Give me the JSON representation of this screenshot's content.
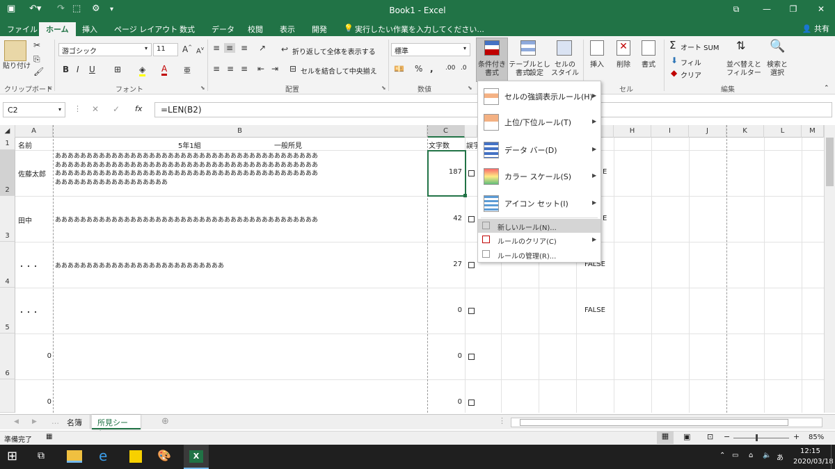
{
  "window": {
    "title": "Book1 - Excel"
  },
  "tabs": {
    "items": [
      "ファイル",
      "ホーム",
      "挿入",
      "ページ レイアウト",
      "数式",
      "データ",
      "校閲",
      "表示",
      "開発"
    ],
    "tellme": "実行したい作業を入力してください...",
    "share": "共有"
  },
  "ribbon": {
    "paste": "貼り付け",
    "font_name": "游ゴシック",
    "font_size": "11",
    "wrap_text": "折り返して全体を表示する",
    "merge_center": "セルを結合して中央揃え",
    "number_format": "標準",
    "cond_format_1": "条件付き",
    "cond_format_2": "書式",
    "table_format_1": "テーブルとして",
    "table_format_2": "書式設定",
    "cell_style_1": "セルの",
    "cell_style_2": "スタイル",
    "insert": "挿入",
    "delete": "削除",
    "format": "書式",
    "autosum": "オート SUM",
    "fill": "フィル",
    "clear": "クリア",
    "sort_1": "並べ替えと",
    "sort_2": "フィルター",
    "find_1": "検索と",
    "find_2": "選択",
    "groups": {
      "clipboard": "クリップボード",
      "font": "フォント",
      "alignment": "配置",
      "number": "数値",
      "cells": "セル",
      "editing": "編集"
    }
  },
  "formula_bar": {
    "namebox": "C2",
    "formula": "=LEN(B2)",
    "fx": "fx"
  },
  "columns": [
    "A",
    "B",
    "C",
    "",
    "",
    "",
    "",
    "",
    "H",
    "I",
    "J",
    "K",
    "L",
    "M"
  ],
  "rows": [
    "1",
    "2",
    "3",
    "4",
    "5",
    "6"
  ],
  "cells": {
    "a1": "名前",
    "b1_left": "5年1組",
    "b1_right": "一般所見",
    "c1": "文字数",
    "d1": "誤字",
    "a2": "佐藤太郎",
    "b2_lines": [
      "ああああああああああああああああああああああああああああああああああああああああああ",
      "ああああああああああああああああああああああああああああああああああああああああああ",
      "ああああああああああああああああああああああああああああああああああああああああああ",
      "ああああああああああああああああああ"
    ],
    "c2": "187",
    "h2": "E",
    "a3": "田中",
    "b3": "ああああああああああああああああああああああああああああああああああああああああああ",
    "c3": "42",
    "h3": "E",
    "a4": "・・・",
    "b4": "あああああああああああああああああああああああああああ",
    "c4": "27",
    "h4": "FALSE",
    "a5": "・・・",
    "c5": "0",
    "h5": "FALSE",
    "a6": "0",
    "c6": "0",
    "a7": "0",
    "c7": "0"
  },
  "menu": {
    "items": [
      {
        "label": "セルの強調表示ルール(H)"
      },
      {
        "label": "上位/下位ルール(T)"
      },
      {
        "label": "データ バー(D)"
      },
      {
        "label": "カラー スケール(S)"
      },
      {
        "label": "アイコン セット(I)"
      }
    ],
    "small_items": [
      {
        "label": "新しいルール(N)..."
      },
      {
        "label": "ルールのクリア(C)"
      },
      {
        "label": "ルールの管理(R)..."
      }
    ]
  },
  "sheets": [
    "名簿",
    "所見シート"
  ],
  "status": {
    "ready": "準備完了",
    "zoom": "85%"
  },
  "taskbar": {
    "time": "12:15",
    "date": "2020/03/18"
  },
  "colors": {
    "excel_green": "#217346"
  }
}
